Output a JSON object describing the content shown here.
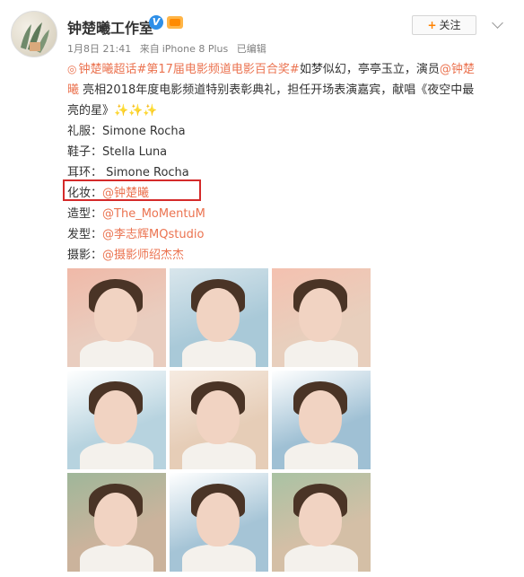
{
  "header": {
    "account_name": "钟楚曦工作室",
    "verified_badge": "V",
    "follow_label": "关注",
    "follow_plus": "+",
    "timestamp": "1月8日 21:41",
    "source_prefix": "来自",
    "source_device": "iPhone 8 Plus",
    "edited_label": "已编辑"
  },
  "post": {
    "line1_link": "钟楚曦超话",
    "line1_link2": "#第17届电影频道电影百合奖#",
    "line1_rest": "如梦似幻，亭亭玉立，演员",
    "line1_mention": "@钟楚",
    "line2_mention": "曦",
    "line2_rest": " 亮相2018年度电影频道特别表彰典礼，担任开场表演嘉宾，献唱《夜空中最",
    "line3": "亮的星》✨✨✨",
    "credits": [
      {
        "label": "礼服：",
        "value": "Simone Rocha",
        "is_link": false
      },
      {
        "label": "鞋子：",
        "value": "Stella Luna",
        "is_link": false
      },
      {
        "label": "耳环：",
        "value": " Simone Rocha",
        "is_link": false
      },
      {
        "label": "化妆：",
        "value": "@钟楚曦",
        "is_link": true
      },
      {
        "label": "造型：",
        "value": "@The_MoMentuM",
        "is_link": true
      },
      {
        "label": "发型：",
        "value": "@李志辉MQstudio",
        "is_link": true
      },
      {
        "label": "摄影：",
        "value": "@摄影师绍杰杰",
        "is_link": true
      }
    ]
  },
  "photos": [
    {
      "bg": "#e9cdbf",
      "accent": "#f0b9a8"
    },
    {
      "bg": "#a9c9d8",
      "accent": "#d9e6ec"
    },
    {
      "bg": "#e8cfbd",
      "accent": "#f4c1b0"
    },
    {
      "bg": "#b7d3df",
      "accent": "#ffffff"
    },
    {
      "bg": "#e6cdb7",
      "accent": "#f6ebe1"
    },
    {
      "bg": "#9fc0d4",
      "accent": "#ffffff"
    },
    {
      "bg": "#cbb39c",
      "accent": "#9fb79a"
    },
    {
      "bg": "#a5c4d6",
      "accent": "#ffffff"
    },
    {
      "bg": "#d4bfa6",
      "accent": "#a9c2a3"
    }
  ],
  "colors": {
    "link": "#eb7350",
    "highlight_box": "#d42a2a",
    "verified": "#2e8fe8",
    "follow_plus": "#ff8200"
  }
}
